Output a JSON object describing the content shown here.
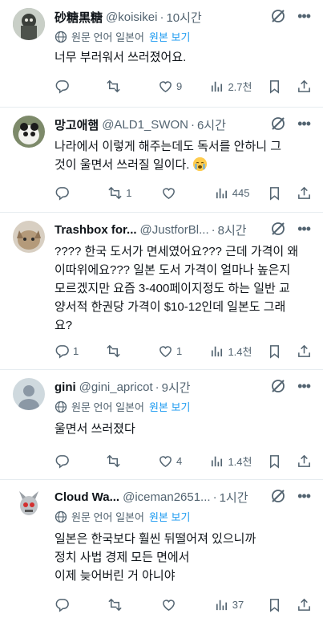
{
  "ui": {
    "translate_label": "원문 언어 일본어",
    "show_original": "원본 보기"
  },
  "tweets": [
    {
      "name": "砂糖黒糖",
      "handle": "@koisikei",
      "time": "10시간",
      "translated": true,
      "lines": [
        "너무 부러워서 쓰러졌어요."
      ],
      "replies": "",
      "retweets": "",
      "likes": "9",
      "views": "2.7천"
    },
    {
      "name": "망고애햄",
      "handle": "@ALD1_SWON",
      "time": "6시간",
      "translated": false,
      "lines": [
        "나라에서 이렇게 해주는데도 독서를 안하니 그",
        "것이 울면서 쓰러질 일이다."
      ],
      "emoji": "crying-face-emoji",
      "replies": "",
      "retweets": "1",
      "likes": "",
      "views": "445"
    },
    {
      "name": "Trashbox for...",
      "handle": "@JustforBl...",
      "time": "8시간",
      "translated": false,
      "lines": [
        "???? 한국 도서가 면세였어요??? 근데 가격이 왜",
        "이따위에요??? 일본 도서 가격이 얼마나 높은지",
        "모르겠지만 요즘 3-400페이지정도 하는 일반 교",
        "양서적 한권당 가격이 $10-12인데 일본도 그래",
        "요?"
      ],
      "replies": "1",
      "retweets": "",
      "likes": "1",
      "views": "1.4천"
    },
    {
      "name": "gini",
      "handle": "@gini_apricot",
      "time": "9시간",
      "translated": true,
      "lines": [
        "울면서 쓰러졌다"
      ],
      "replies": "",
      "retweets": "",
      "likes": "4",
      "views": "1.4천"
    },
    {
      "name": "Cloud Wa...",
      "handle": "@iceman2651...",
      "time": "1시간",
      "translated": true,
      "lines": [
        "일본은 한국보다 훨씬 뒤떨어져 있으니까",
        "정치 사법 경제 모든 면에서",
        "이제 늦어버린 거 아니야"
      ],
      "replies": "",
      "retweets": "",
      "likes": "",
      "views": "37"
    }
  ]
}
